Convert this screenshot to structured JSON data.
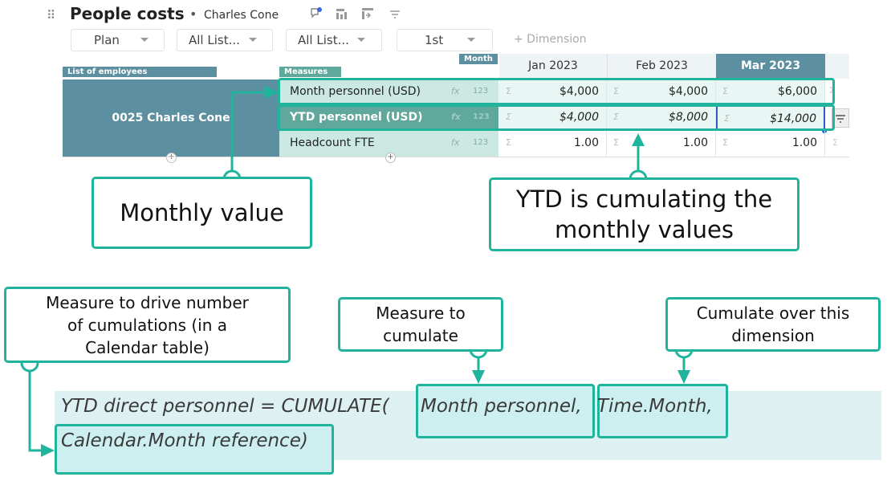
{
  "header": {
    "title": "People costs",
    "separator": "•",
    "subtitle": "Charles Cone",
    "icons": [
      "comment-icon",
      "chart-view-icon",
      "pivot-icon",
      "filter-icon"
    ]
  },
  "filters": [
    {
      "label": "Plan"
    },
    {
      "label": "All List..."
    },
    {
      "label": "All List..."
    },
    {
      "label": "1st"
    }
  ],
  "add_dimension": "+ Dimension",
  "grid": {
    "row_dim_tag": "List of employees",
    "measures_tag": "Measures",
    "col_dim_tag": "Month",
    "employee": "0025 Charles Cone",
    "columns": [
      "Jan 2023",
      "Feb 2023",
      "Mar 2023"
    ],
    "fx": "fx",
    "type_label": "123",
    "sigma": "Σ",
    "rows": [
      {
        "name": "Month personnel (USD)",
        "values": [
          "$4,000",
          "$4,000",
          "$6,000"
        ]
      },
      {
        "name": "YTD personnel (USD)",
        "values": [
          "$4,000",
          "$8,000",
          "$14,000"
        ]
      },
      {
        "name": "Headcount FTE",
        "values": [
          "1.00",
          "1.00",
          "1.00"
        ]
      }
    ]
  },
  "callouts": {
    "monthly": "Monthly value",
    "ytd_line1": "YTD is cumulating the",
    "ytd_line2": "monthly values",
    "measure_drive_1": "Measure to drive number",
    "measure_drive_2": "of cumulations (in a",
    "measure_drive_3": "Calendar table)",
    "measure_cum_1": "Measure to",
    "measure_cum_2": "cumulate",
    "over_dim_1": "Cumulate over this",
    "over_dim_2": "dimension"
  },
  "formula": {
    "part1": "YTD direct personnel = CUMULATE(",
    "part2": "Month personnel,",
    "part3": " Time.Month,",
    "line2": "Calendar.Month reference)"
  },
  "colors": {
    "accent": "#1fb49b",
    "employee_block": "#5c8fa0",
    "measure_bg": "#cbe9e2",
    "selected_col": "#5c8fa0"
  }
}
